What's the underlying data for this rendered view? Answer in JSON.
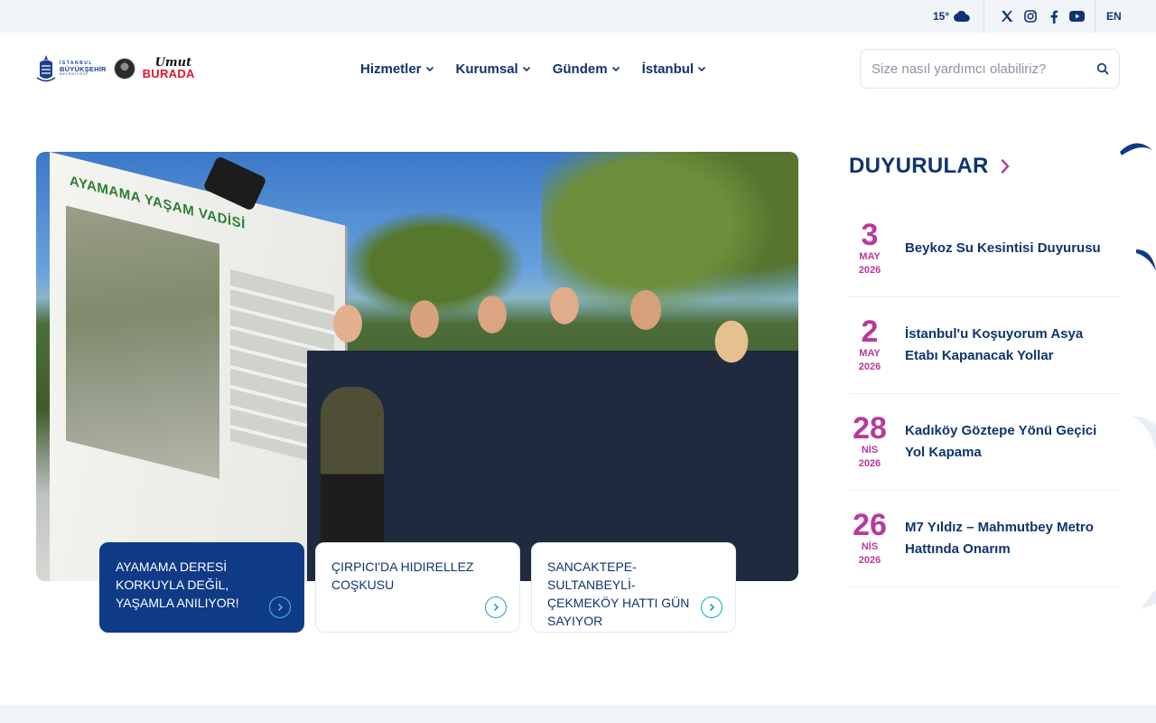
{
  "topbar": {
    "temperature": "15°",
    "weather_icon": "cloud-icon",
    "social_icons": [
      "x-icon",
      "instagram-icon",
      "facebook-icon",
      "youtube-icon"
    ],
    "language": "EN"
  },
  "header": {
    "logo": {
      "line1": "İSTANBUL",
      "line2": "BÜYÜKŞEHİR",
      "line3": "BELEDİYESİ"
    },
    "campaign": {
      "line1": "Umut",
      "line2": "BURADA"
    },
    "nav": [
      {
        "label": "Hizmetler"
      },
      {
        "label": "Kurumsal"
      },
      {
        "label": "Gündem"
      },
      {
        "label": "İstanbul"
      }
    ],
    "search_placeholder": "Size nasıl yardımcı olabiliriz?"
  },
  "hero": {
    "board_title": "AYAMAMA YAŞAM VADİSİ",
    "cards": [
      {
        "label": "AYAMAMA DERESİ KORKUYLA DEĞİL, YAŞAMLA ANILIYOR!",
        "active": true
      },
      {
        "label": "ÇIRPICI'DA HIDIRELLEZ COŞKUSU",
        "active": false
      },
      {
        "label": "SANCAKTEPE-SULTANBEYLİ-ÇEKMEKÖY HATTI GÜN SAYIYOR",
        "active": false
      }
    ]
  },
  "announcements": {
    "title": "DUYURULAR",
    "items": [
      {
        "day": "3",
        "month": "MAY",
        "year": "2026",
        "text": "Beykoz Su Kesintisi Duyurusu"
      },
      {
        "day": "2",
        "month": "MAY",
        "year": "2026",
        "text": "İstanbul'u Koşuyorum Asya Etabı Kapanacak Yollar"
      },
      {
        "day": "28",
        "month": "NİS",
        "year": "2026",
        "text": "Kadıköy Göztepe Yönü Geçici Yol Kapama"
      },
      {
        "day": "26",
        "month": "NİS",
        "year": "2026",
        "text": "M7 Yıldız – Mahmutbey Metro Hattında Onarım"
      }
    ]
  },
  "colors": {
    "primary": "#0f3470",
    "accent": "#b8399b",
    "active_card": "#0f3b86",
    "arrow": "#1aa3c9"
  }
}
